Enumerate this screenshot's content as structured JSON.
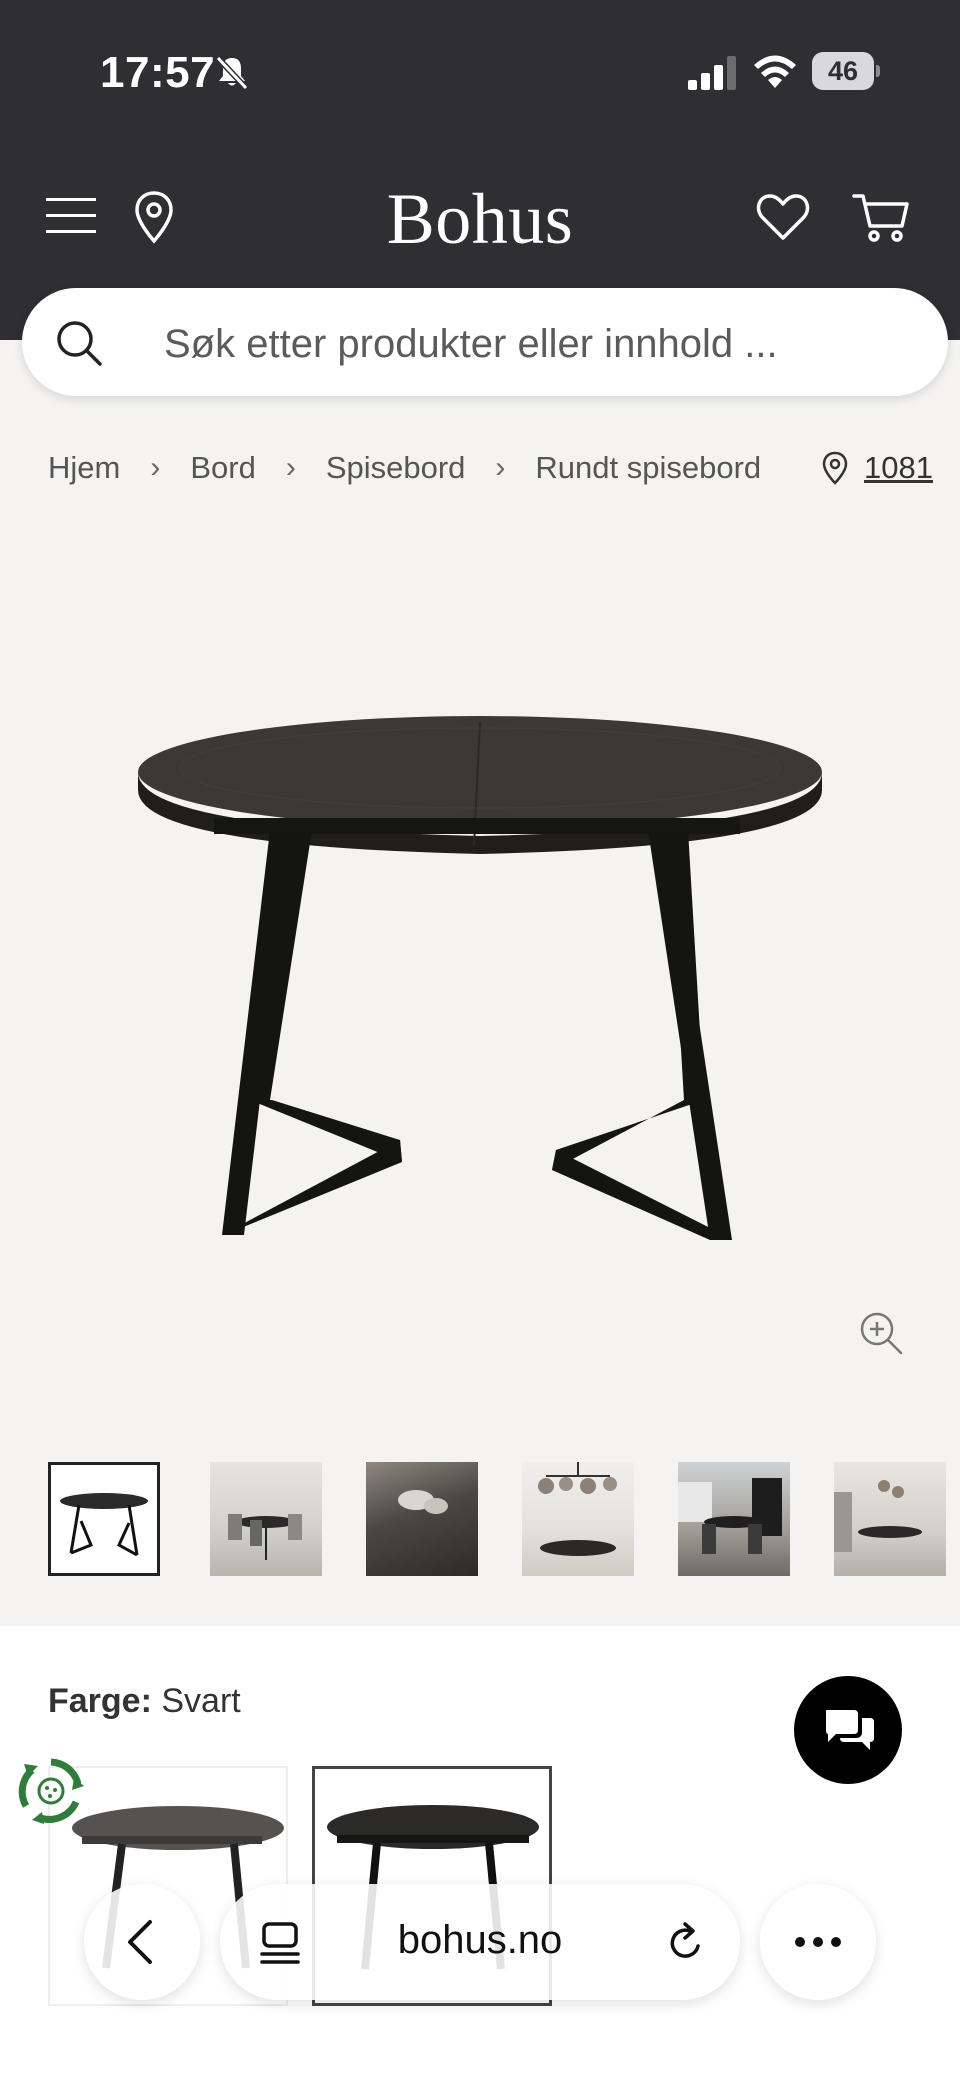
{
  "status_bar": {
    "time": "17:57",
    "battery": "46"
  },
  "header": {
    "logo": "Bohus"
  },
  "search": {
    "placeholder": "Søk etter produkter eller innhold ..."
  },
  "breadcrumb": {
    "items": [
      "Hjem",
      "Bord",
      "Spisebord",
      "Rundt spisebord"
    ],
    "store_code": "1081"
  },
  "product": {
    "image_alt": "Rundt spisebord",
    "thumbnail_count": 6,
    "selected_thumbnail": 0
  },
  "options": {
    "color_label": "Farge:",
    "color_value": "Svart",
    "selected_swatch": 1
  },
  "browser": {
    "url": "bohus.no"
  },
  "colors": {
    "header_bg": "#2e2e33",
    "page_bg": "#f4f3f1",
    "eco_green": "#2f7d3a"
  }
}
